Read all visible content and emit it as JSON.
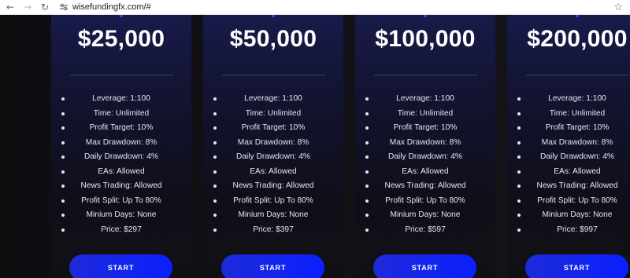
{
  "browser": {
    "url": "wisefundingfx.com/#",
    "back_icon": "←",
    "forward_icon": "→",
    "reload_icon": "↻",
    "star_icon": "☆"
  },
  "colors": {
    "accent": "#0a1fff",
    "card_top": "#181a4a",
    "background": "#0e0e11"
  },
  "plans": [
    {
      "price": "$25,000",
      "features": [
        "Leverage: 1:100",
        "Time: Unlimited",
        "Profit Target: 10%",
        "Max Drawdown: 8%",
        "Daily Drawdown: 4%",
        "EAs: Allowed",
        "News Trading: Allowed",
        "Profit Split: Up To 80%",
        "Minium Days: None",
        "Price: $297"
      ],
      "button_label": "START"
    },
    {
      "price": "$50,000",
      "features": [
        "Leverage: 1:100",
        "Time: Unlimited",
        "Profit Target: 10%",
        "Max Drawdown: 8%",
        "Daily Drawdown: 4%",
        "EAs: Allowed",
        "News Trading: Allowed",
        "Profit Split: Up To 80%",
        "Minium Days: None",
        "Price: $397"
      ],
      "button_label": "START"
    },
    {
      "price": "$100,000",
      "features": [
        "Leverage: 1:100",
        "Time: Unlimited",
        "Profit Target: 10%",
        "Max Drawdown: 8%",
        "Daily Drawdown: 4%",
        "EAs: Allowed",
        "News Trading: Allowed",
        "Profit Split: Up To 80%",
        "Minium Days: None",
        "Price: $597"
      ],
      "button_label": "START"
    },
    {
      "price": "$200,000",
      "features": [
        "Leverage: 1:100",
        "Time: Unlimited",
        "Profit Target: 10%",
        "Max Drawdown: 8%",
        "Daily Drawdown: 4%",
        "EAs: Allowed",
        "News Trading: Allowed",
        "Profit Split: Up To 80%",
        "Minium Days: None",
        "Price: $997"
      ],
      "button_label": "START"
    }
  ]
}
